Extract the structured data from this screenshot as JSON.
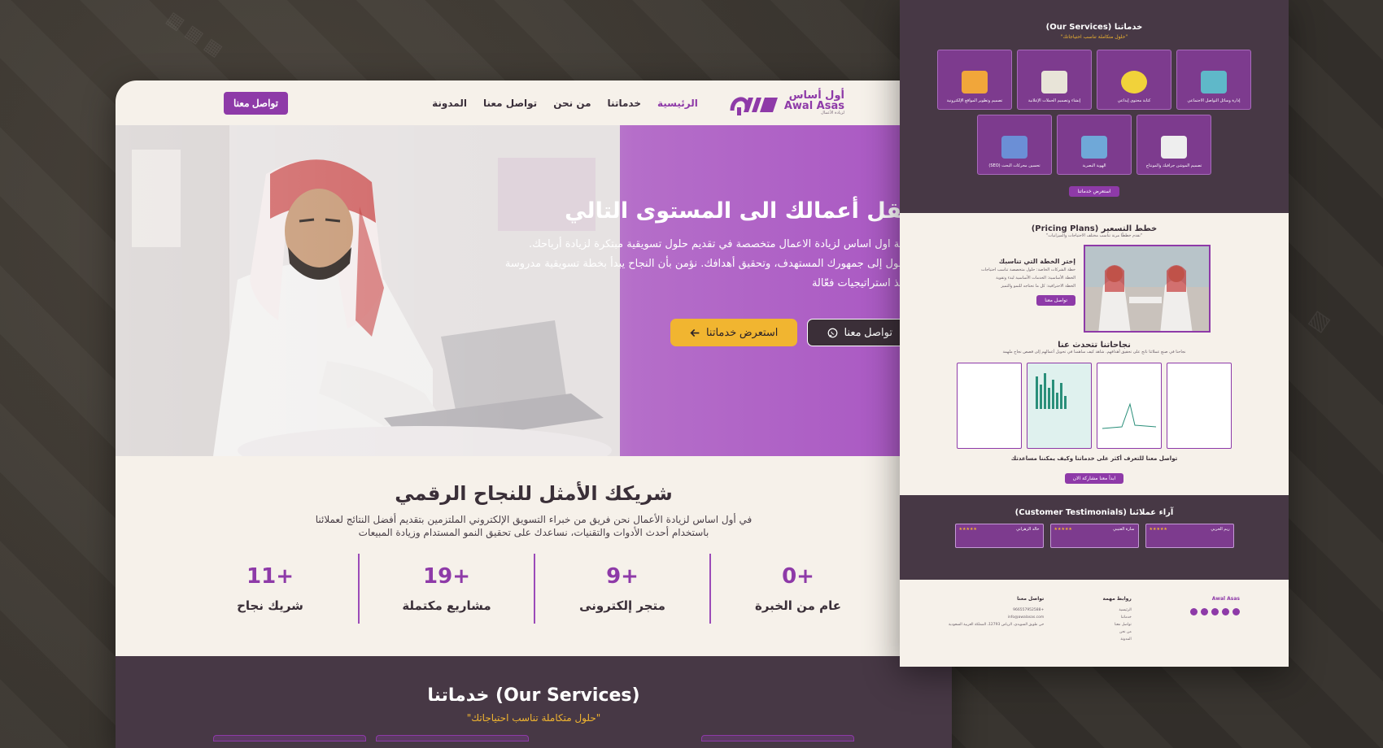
{
  "nav": {
    "contact_button": "تواصل معنا",
    "items": [
      "الرئيسية",
      "خدماتنا",
      "من نحن",
      "تواصل معنا",
      "المدونة"
    ],
    "logo_ar": "أول أساس",
    "logo_en": "Awal Asas",
    "logo_tag": "لزيادة الأعمال"
  },
  "hero": {
    "title": "ننقل أعمالك الى المستوى التالي",
    "description": "شركة اول اساس لزيادة الاعمال متخصصة في تقديم حلول تسويقية مبتكرة لزيادة أرباحك. الوصول إلى جمهورك المستهدف، وتحقيق أهدافك. نؤمن بأن النجاح يبدأ بخطة تسويقية مدروسة وتنفيذ استراتيجيات فعّالة",
    "contact_button": "تواصل معنا",
    "services_button": "استعرض خدماتنا"
  },
  "partner": {
    "title": "شريكك الأمثل للنجاح الرقمي",
    "line1": "في أول اساس لزيادة الأعمال نحن فريق من خبراء التسويق الإلكتروني الملتزمين بتقديم أفضل النتائج لعملائنا",
    "line2": "باستخدام أحدث الأدوات والتقنيات، نساعدك على تحقيق النمو المستدام وزيادة المبيعات"
  },
  "stats": [
    {
      "num": "+0",
      "label": "عام من الخبرة"
    },
    {
      "num": "+9",
      "label": "متجر إلكترونى"
    },
    {
      "num": "+19",
      "label": "مشاريع مكتملة"
    },
    {
      "num": "+11",
      "label": "شريك نجاح"
    }
  ],
  "services": {
    "title": "خدماتنا (Our Services)",
    "subtitle": "\"حلول متكاملة تناسب احتياجاتك\""
  },
  "side": {
    "services_title": "خدماتنا (Our Services)",
    "services_sub": "\"حلول متكاملة تناسب احتياجاتك\"",
    "cards": [
      "إدارة وسائل التواصل الاجتماعي",
      "كتابة محتوى إبداعي",
      "إنشاء وتصميم الحملات الإعلانية",
      "تصميم وتطوير المواقع الإلكترونية",
      "تصميم الموشن جرافيك والمونتاج",
      "الهوية البصرية",
      "تحسين محركات البحث (SEO)"
    ],
    "services_btn": "استعرض خدماتنا",
    "pricing_title": "خطط التسعير (Pricing Plans)",
    "pricing_sub": "\"نقدم خططًا مرنة تناسب مختلف الاحتياجات والميزانيات\"",
    "plan_title": "إختر الخطة التي تناسبك",
    "plan_l1": "خطة الشركات الخاصة: حلول متخصصة تناسب احتياجات",
    "plan_l2": "الخطة الأساسية: الخدمات الأساسية لبدء وتقوية",
    "plan_l3": "الخطة الاحترافية: كل ما تحتاجه للنمو والتميز",
    "plan_btn": "تواصل معنا",
    "success_title": "نجاحاتنا تتحدث عنا",
    "success_sub": "نجاحنا في صنع عملائنا ناتج على تحقيق أهدافهم. شاهد كيف ساهمنا في تحويل أعمالهم إلى قصص نجاح ملهمة",
    "cta": "تواصل معنا للتعرف أكثر على خدماتنا وكيف يمكننا مساعدتك",
    "cta_btn": "ابدأ معنا مشاركة الان",
    "test_title": "آراء عملائنا (Customer Testimonials)",
    "testimonials": [
      "ريم الحربي",
      "سارة العتيبي",
      "خالد الزهراني"
    ],
    "stars": "★★★★★",
    "foot_contact": "تواصل معنا",
    "foot_links": "روابط مهمة",
    "phone": "+966557952588",
    "email": "info@awalasas.com",
    "address": "حي طويق السويدي، الرياض 12793، المملكة العربية السعودية",
    "links": [
      "الرئيسية",
      "خدماتنا",
      "تواصل معنا",
      "من نحن",
      "المدونة"
    ]
  },
  "colors": {
    "accent": "#8e3aa8",
    "dark": "#473845",
    "yellow": "#f1b530",
    "cream": "#f6f1ea"
  }
}
